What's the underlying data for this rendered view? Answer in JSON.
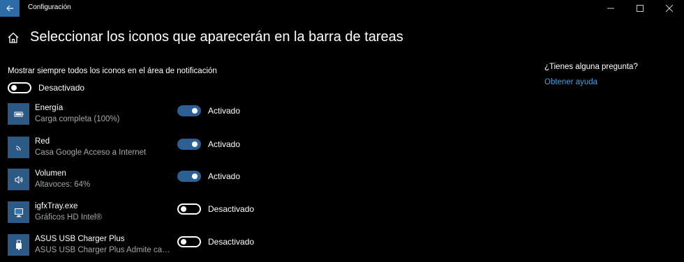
{
  "window": {
    "title": "Configuración",
    "controls": [
      "minimize-icon",
      "maximize-icon",
      "close-icon"
    ]
  },
  "page": {
    "title": "Seleccionar los iconos que aparecerán en la barra de tareas"
  },
  "always_show": {
    "label": "Mostrar siempre todos los iconos en el área de notificación",
    "state": false,
    "state_label": "Desactivado"
  },
  "items": [
    {
      "name": "Energía",
      "desc": "Carga completa (100%)",
      "icon": "battery-icon",
      "state": true,
      "state_label": "Activado"
    },
    {
      "name": "Red",
      "desc": "Casa Google Acceso a Internet",
      "icon": "wifi-icon",
      "state": true,
      "state_label": "Activado"
    },
    {
      "name": "Volumen",
      "desc": "Altavoces: 64%",
      "icon": "speaker-icon",
      "state": true,
      "state_label": "Activado"
    },
    {
      "name": "igfxTray.exe",
      "desc": "Gráficos HD Intel®",
      "icon": "intel-graphics-icon",
      "state": false,
      "state_label": "Desactivado"
    },
    {
      "name": "ASUS USB Charger Plus",
      "desc": "ASUS USB Charger Plus Admite carga",
      "icon": "usb-charger-icon",
      "state": false,
      "state_label": "Desactivado"
    }
  ],
  "help": {
    "question": "¿Tienes alguna pregunta?",
    "link": "Obtener ayuda"
  },
  "colors": {
    "accent": "#2d5f93",
    "icon_tile": "#2d5a85",
    "link": "#4f9fe0",
    "secondary_text": "#a6a6a6"
  }
}
